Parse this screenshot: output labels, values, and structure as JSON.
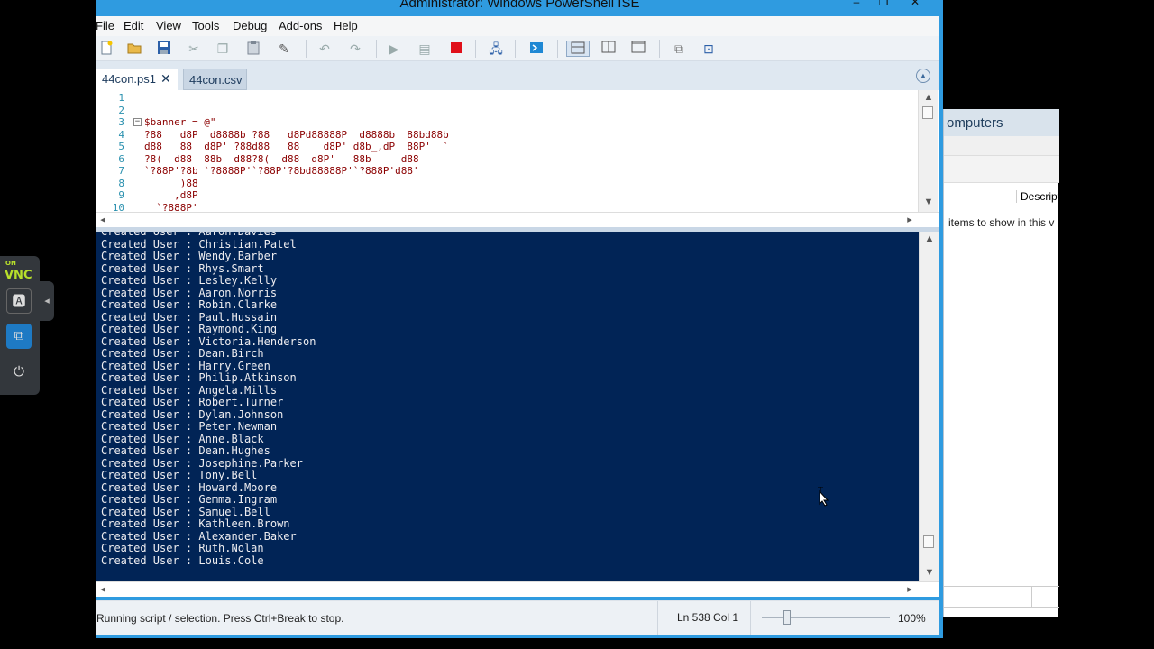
{
  "window": {
    "title": "Administrator: Windows PowerShell ISE",
    "minimize_glyph": "‒",
    "maximize_glyph": "❐",
    "close_glyph": "✕"
  },
  "menu": [
    "File",
    "Edit",
    "View",
    "Tools",
    "Debug",
    "Add-ons",
    "Help"
  ],
  "toolbar_icons": [
    "new-icon",
    "open-icon",
    "save-icon",
    "cut-icon",
    "copy-icon",
    "paste-icon",
    "clear-icon",
    "undo-icon",
    "redo-icon",
    "run-icon",
    "run-selection-icon",
    "stop-icon",
    "remote-powershell-icon",
    "powershell-console-icon",
    "layout-top-icon",
    "layout-right-icon",
    "layout-max-icon",
    "show-commands-icon",
    "command-addon-icon"
  ],
  "tabs": [
    {
      "label": "44con.ps1",
      "active": true
    },
    {
      "label": "44con.csv",
      "active": false
    }
  ],
  "editor": {
    "line_numbers": [
      "1",
      "2",
      "3",
      "4",
      "5",
      "6",
      "7",
      "8",
      "9",
      "10"
    ],
    "code_lines": [
      "",
      "",
      "$banner = @\"",
      "?88   d8P  d8888b ?88   d8Pd88888P  d8888b  88bd88b",
      "d88   88  d8P' ?88d88   88    d8P' d8b_,dP  88P'  `",
      "?8(  d88  88b  d88?8(  d88  d8P'   88b     d88",
      "`?88P'?8b `?8888P'`?88P'?8bd88888P'`?888P'd88'",
      "      )88",
      "     ,d8P",
      "  `?888P'"
    ]
  },
  "console": {
    "first_line": "Created User : Aaron.Davies",
    "lines": [
      "Created User : Christian.Patel",
      "Created User : Wendy.Barber",
      "Created User : Rhys.Smart",
      "Created User : Lesley.Kelly",
      "Created User : Aaron.Norris",
      "Created User : Robin.Clarke",
      "Created User : Paul.Hussain",
      "Created User : Raymond.King",
      "Created User : Victoria.Henderson",
      "Created User : Dean.Birch",
      "Created User : Harry.Green",
      "Created User : Philip.Atkinson",
      "Created User : Angela.Mills",
      "Created User : Robert.Turner",
      "Created User : Dylan.Johnson",
      "Created User : Peter.Newman",
      "Created User : Anne.Black",
      "Created User : Dean.Hughes",
      "Created User : Josephine.Parker",
      "Created User : Tony.Bell",
      "Created User : Howard.Moore",
      "Created User : Gemma.Ingram",
      "Created User : Samuel.Bell",
      "Created User : Kathleen.Brown",
      "Created User : Alexander.Baker",
      "Created User : Ruth.Nolan",
      "Created User : Louis.Cole"
    ]
  },
  "status": {
    "message": "Running script / selection.  Press Ctrl+Break to stop.",
    "position": "Ln 538  Col 1",
    "zoom": "100%",
    "zoom_level": 0.2
  },
  "background_window": {
    "title": "omputers",
    "column_header": "Descript",
    "empty_message": "items to show in this v"
  },
  "vnc": {
    "logo": "VNC",
    "logo_small": "ON",
    "collapse_glyph": "◂",
    "buttons": [
      {
        "name": "vnc-keyboard-button",
        "glyph": "🅰"
      },
      {
        "name": "vnc-scale-button",
        "glyph": "⧉"
      },
      {
        "name": "vnc-power-button",
        "glyph": "⏻"
      }
    ]
  },
  "colors": {
    "console_bg": "#012456",
    "console_text": "#EEEDF0",
    "code_string": "#8B0000",
    "line_number": "#2B91AF",
    "ise_frame": "#2F9BE0"
  }
}
